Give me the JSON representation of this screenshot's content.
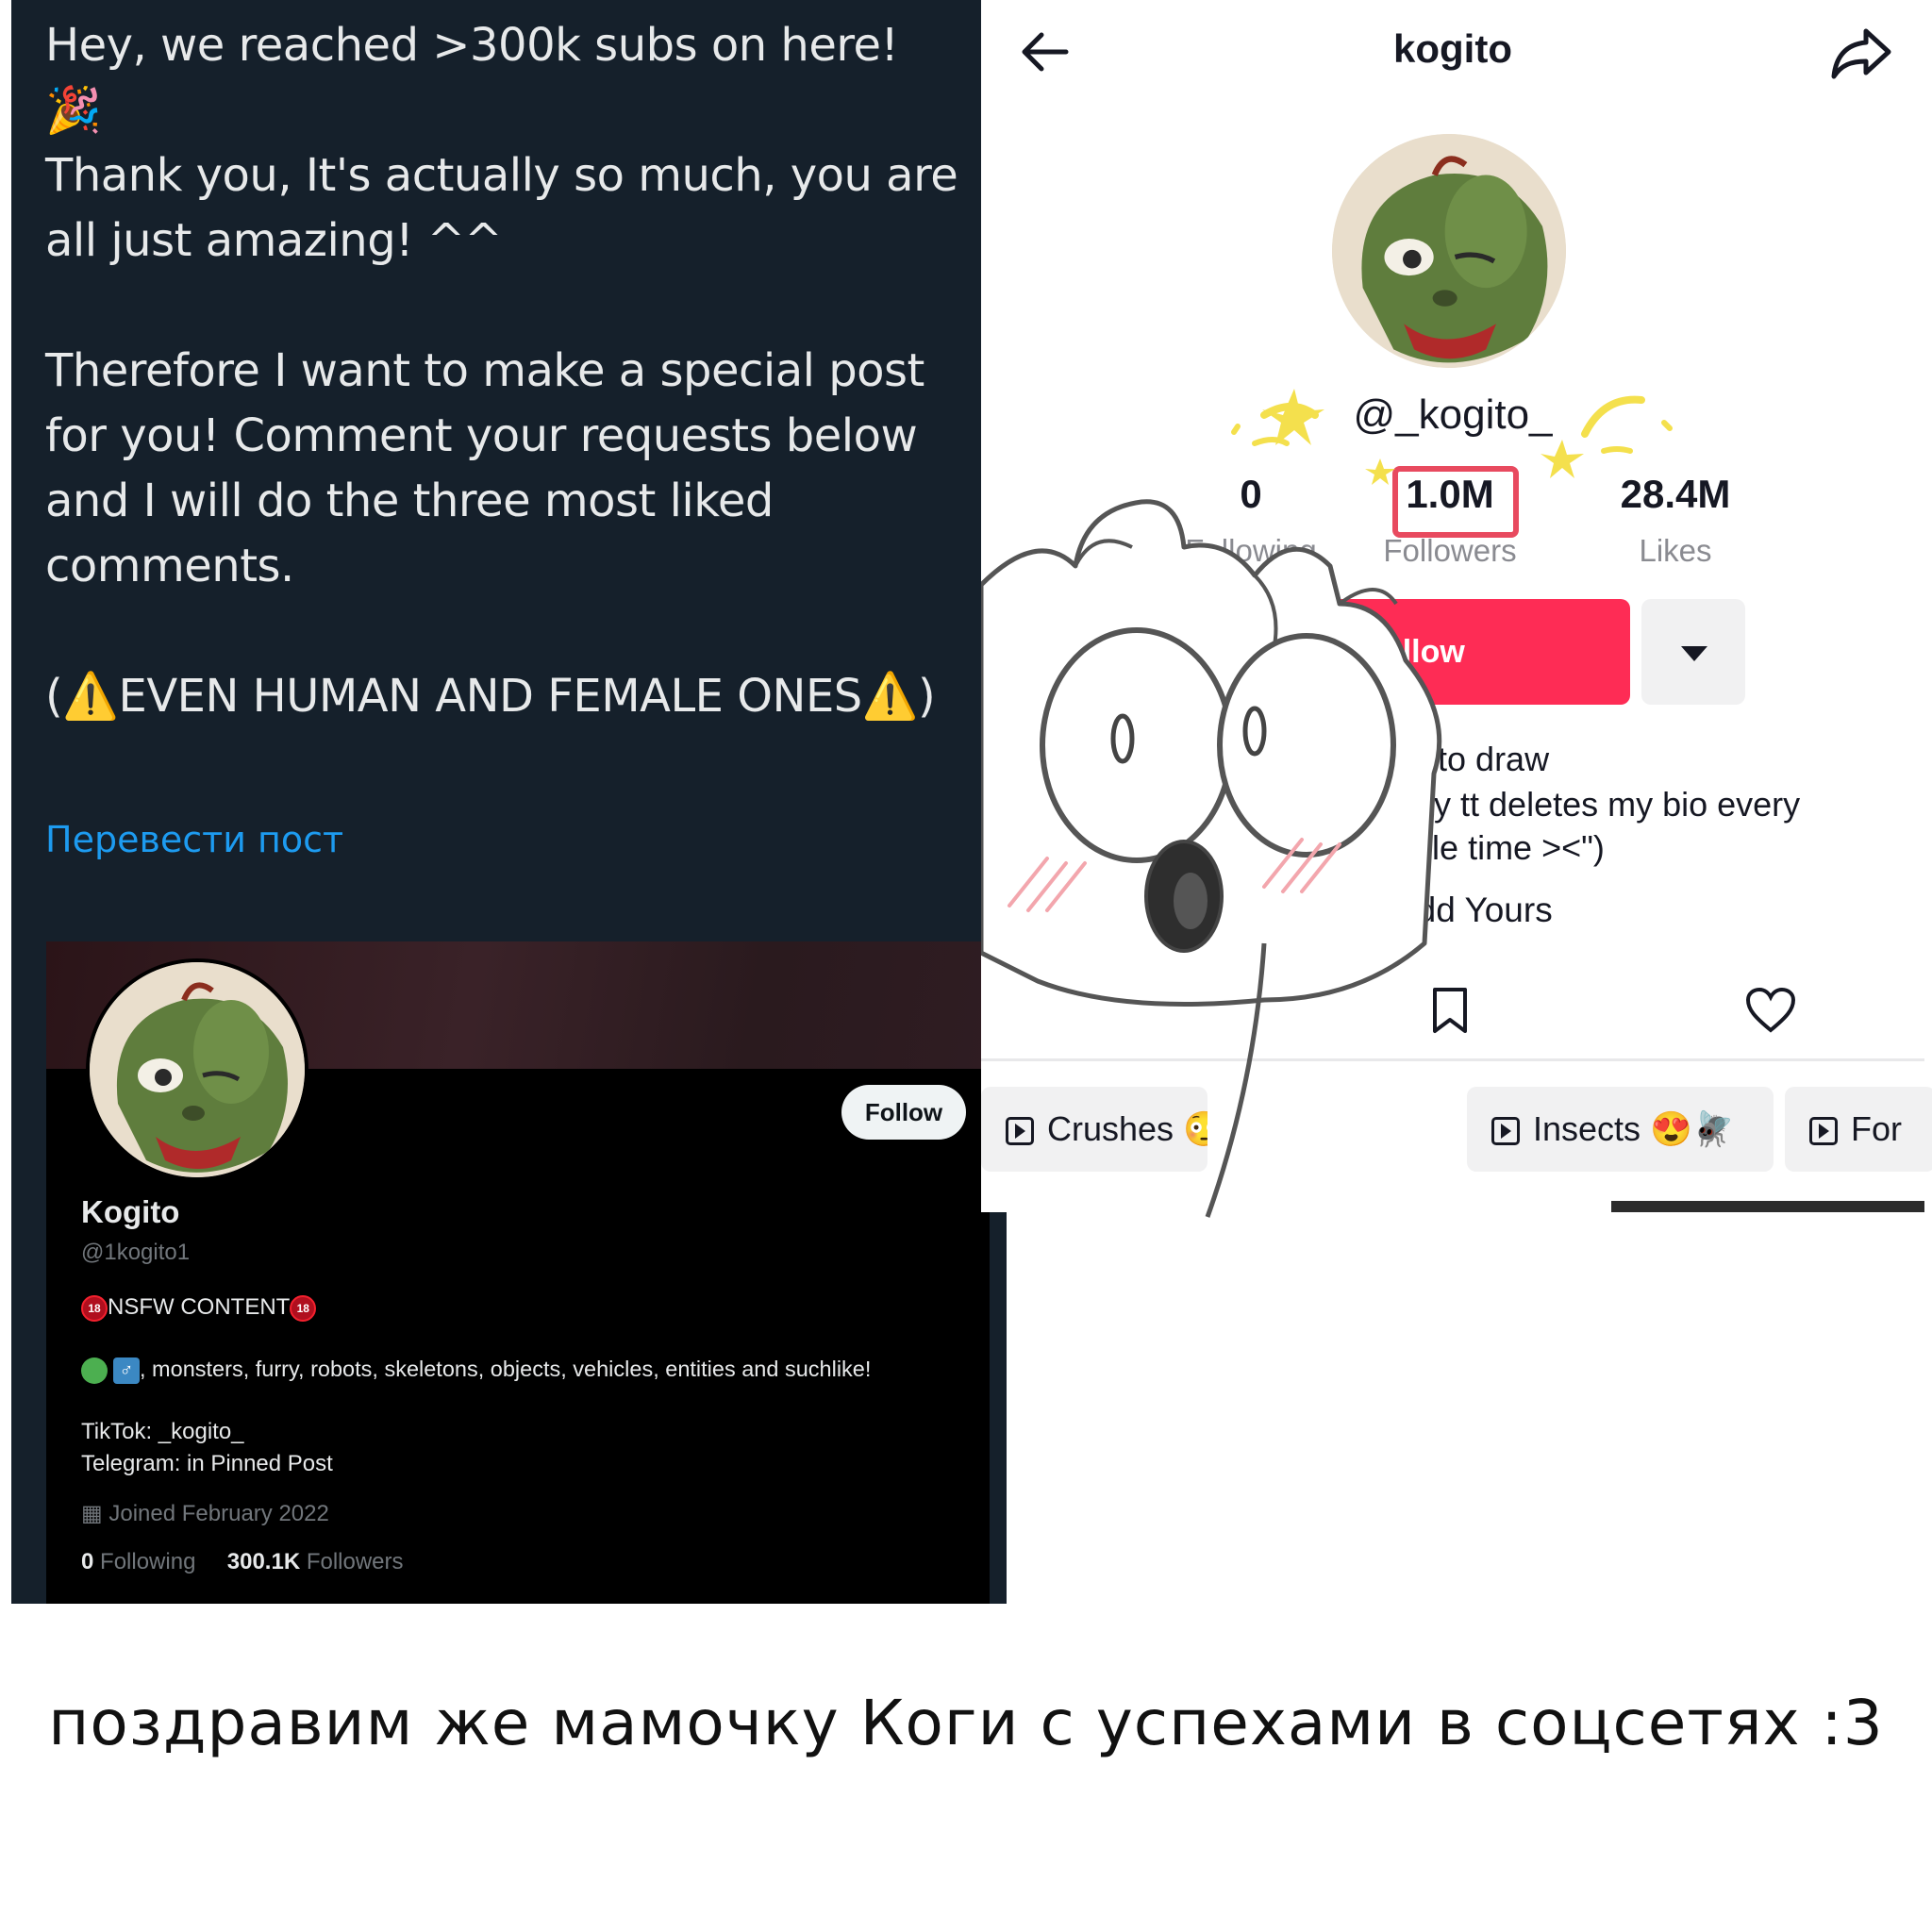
{
  "tweet": {
    "text": "Hey, we reached >300k subs on here!\n🎉\nThank you, It's actually so much, you are all just amazing! ^^\n\nTherefore I want to make a special post for you! Comment your requests below and I will do the three most liked comments.\n\n(⚠️EVEN HUMAN AND FEMALE ONES⚠️)",
    "translate_link": "Перевести пост"
  },
  "x_profile": {
    "follow_label": "Follow",
    "name": "Kogito",
    "handle": "@1kogito1",
    "nsfw_badge": "18",
    "nsfw_text": "NSFW CONTENT",
    "male_symbol": "♂",
    "bio": ", monsters, furry, robots, skeletons, objects, vehicles, entities and suchlike!",
    "tiktok": "TikTok: _kogito_",
    "telegram": "Telegram: in Pinned Post",
    "calendar_icon": "▦",
    "joined": "Joined February 2022",
    "following_count": "0",
    "following_label": "Following",
    "followers_count": "300.1K",
    "followers_label": "Followers"
  },
  "tiktok": {
    "title": "kogito",
    "username": "@_kogito_",
    "stats": [
      {
        "value": "0",
        "label": "Following"
      },
      {
        "value": "1.0M",
        "label": "Followers"
      },
      {
        "value": "28.4M",
        "label": "Likes"
      }
    ],
    "follow_label": "Follow",
    "bio_lines": [
      "I like to draw",
      "(I say tt deletes my bio every",
      "single time ><\")"
    ],
    "add_yours": "Add Yours",
    "playlists": [
      "Crushes 😳🌻",
      "Insects 😍🪰",
      "For"
    ]
  },
  "caption": "поздравим же мамочку Коги с успехами в соцсетях :3",
  "colors": {
    "x_bg": "#15202b",
    "x_link": "#1d9bf0",
    "tiktok_red": "#fe2c55",
    "highlight_box": "#e84a5f"
  }
}
